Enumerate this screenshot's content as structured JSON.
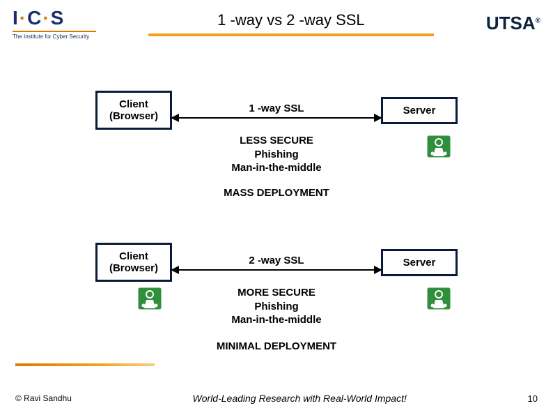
{
  "header": {
    "ics_main_1": "I",
    "ics_main_2": "C",
    "ics_main_3": "S",
    "ics_sub": "The Institute for Cyber Security",
    "title": "1 -way vs 2 -way SSL",
    "utsa": "UTSA"
  },
  "diagram": {
    "client_label_1": "Client",
    "client_label_2": "(Browser)",
    "server_label": "Server",
    "oneway_label": "1 -way SSL",
    "twoway_label": "2 -way SSL",
    "note1_l1": "LESS SECURE",
    "note1_l2": "Phishing",
    "note1_l3": "Man-in-the-middle",
    "deploy1": "MASS DEPLOYMENT",
    "note2_l1": "MORE SECURE",
    "note2_l2": "Phishing",
    "note2_l3": "Man-in-the-middle",
    "deploy2": "MINIMAL DEPLOYMENT"
  },
  "footer": {
    "copyright": "© Ravi Sandhu",
    "tagline": "World-Leading Research with Real-World Impact!",
    "page": "10"
  },
  "icons": {
    "cert": "certificate-keys-icon"
  }
}
